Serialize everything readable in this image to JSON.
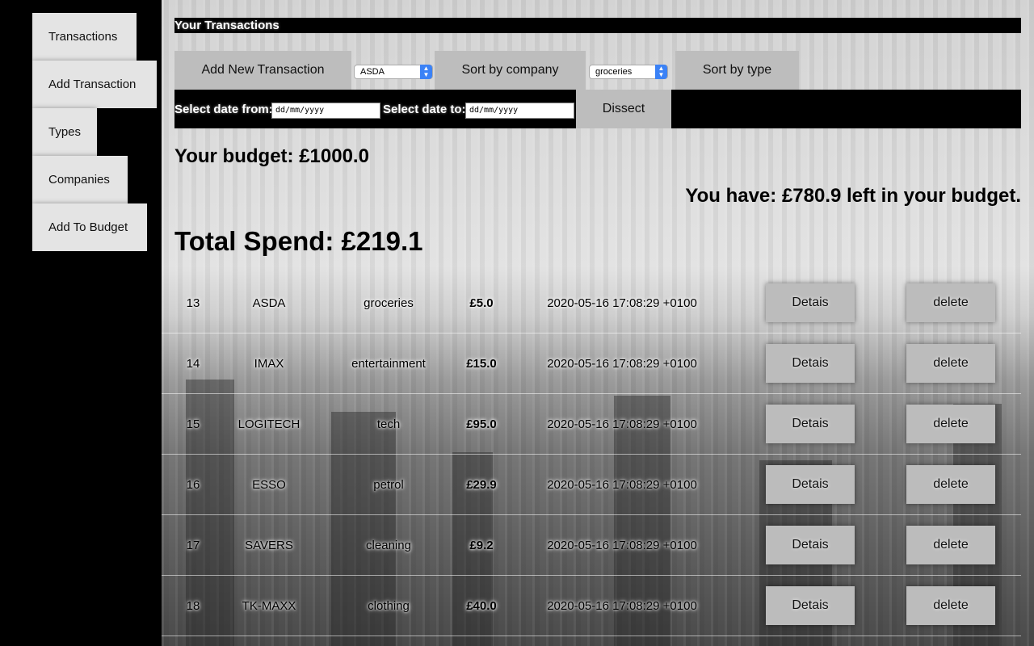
{
  "sidebar": {
    "items": [
      {
        "label": "Transactions"
      },
      {
        "label": "Add Transaction"
      },
      {
        "label": "Types"
      },
      {
        "label": "Companies"
      },
      {
        "label": "Add To Budget"
      }
    ]
  },
  "header": {
    "title": "Your Transactions"
  },
  "toolbar": {
    "add_label": "Add New Transaction",
    "company_select": "ASDA",
    "sort_company_label": "Sort by company",
    "type_select": "groceries",
    "sort_type_label": "Sort by type"
  },
  "dates": {
    "from_label": "Select date from:",
    "from_placeholder": "dd/mm/yyyy",
    "to_label": "Select date to:",
    "to_placeholder": "dd/mm/yyyy",
    "dissect_label": "Dissect"
  },
  "summary": {
    "budget": "Your budget: £1000.0",
    "remaining": "You have: £780.9 left in your budget.",
    "total": "Total Spend: £219.1"
  },
  "table": {
    "details_label": "Detais",
    "delete_label": "delete",
    "rows": [
      {
        "id": "13",
        "company": "ASDA",
        "type": "groceries",
        "amount": "£5.0",
        "date": "2020-05-16 17:08:29 +0100"
      },
      {
        "id": "14",
        "company": "IMAX",
        "type": "entertainment",
        "amount": "£15.0",
        "date": "2020-05-16 17:08:29 +0100"
      },
      {
        "id": "15",
        "company": "LOGITECH",
        "type": "tech",
        "amount": "£95.0",
        "date": "2020-05-16 17:08:29 +0100"
      },
      {
        "id": "16",
        "company": "ESSO",
        "type": "petrol",
        "amount": "£29.9",
        "date": "2020-05-16 17:08:29 +0100"
      },
      {
        "id": "17",
        "company": "SAVERS",
        "type": "cleaning",
        "amount": "£9.2",
        "date": "2020-05-16 17:08:29 +0100"
      },
      {
        "id": "18",
        "company": "TK-MAXX",
        "type": "clothing",
        "amount": "£40.0",
        "date": "2020-05-16 17:08:29 +0100"
      }
    ]
  }
}
